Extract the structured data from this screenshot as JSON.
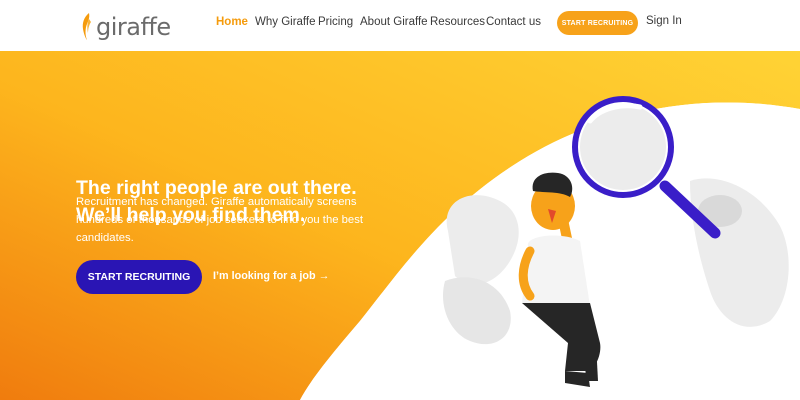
{
  "brand": {
    "name": "giraffe"
  },
  "nav": {
    "links": [
      {
        "label": "Home",
        "active": true
      },
      {
        "label": "Why Giraffe",
        "active": false
      },
      {
        "label": "Pricing",
        "active": false
      },
      {
        "label": "About Giraffe",
        "active": false
      },
      {
        "label": "Resources",
        "active": false
      },
      {
        "label": "Contact us",
        "active": false
      }
    ],
    "cta_label": "START RECRUITING",
    "signin_label": "Sign In"
  },
  "hero": {
    "headline_line1": "The right people are out there.",
    "headline_line2": "We’ll help you find them.",
    "subtext": "Recruitment has changed. Giraffe automatically screens hundreds of thousands of job seekers to find you the best candidates.",
    "primary_cta_label": "START RECRUITING",
    "secondary_link_label": "I’m looking for a job →"
  },
  "colors": {
    "accent": "#f59b0c",
    "primary_button": "#2a15b4",
    "gradient_start": "#f28a12",
    "gradient_end": "#ffd233"
  },
  "icons": {
    "logo": "giraffe-flame-icon",
    "illustration": "magnifier-person-illustration"
  }
}
